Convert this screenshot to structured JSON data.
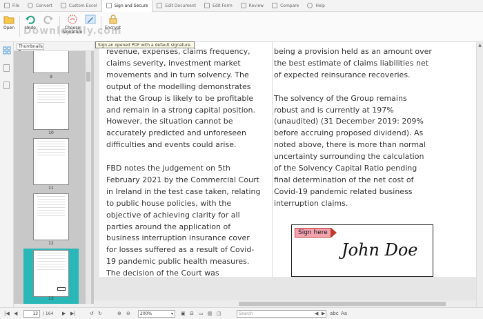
{
  "menubar": {
    "tabs": [
      {
        "label": "File",
        "icon": "file-icon"
      },
      {
        "label": "Convert",
        "icon": "convert-icon"
      },
      {
        "label": "Custom Excel",
        "icon": "table-icon"
      },
      {
        "label": "Sign and Secure",
        "icon": "sign-icon"
      },
      {
        "label": "Edit Document",
        "icon": "edit-icon"
      },
      {
        "label": "Edit Form",
        "icon": "form-icon"
      },
      {
        "label": "Review",
        "icon": "review-icon"
      },
      {
        "label": "Compare",
        "icon": "compare-icon"
      },
      {
        "label": "Help",
        "icon": "help-icon"
      }
    ]
  },
  "ribbon": {
    "open": "Open",
    "undo": "Undo",
    "choose_signature": "Choose Signature",
    "encrypt": "Encrypt",
    "watermark": "Downloadly.com"
  },
  "tooltip": "Sign an opened PDF with a default signature.",
  "thumbnails": {
    "dropdown": "Thumbnails",
    "pages": [
      "9",
      "10",
      "11",
      "12",
      "13"
    ]
  },
  "document": {
    "left_column": [
      "revenue, expenses, claims frequency, claims severity, investment market movements and in turn solvency. The output of the modelling demonstrates that the Group is likely to be profitable and remain in a strong capital position. However, the situation cannot be accurately predicted and unforeseen difficulties and events could arise.",
      "FBD notes the judgement on 5th February 2021 by the Commercial Court in Ireland in the test case taken, relating to public house policies, with the objective of achieving clarity for all parties around the application of business interruption insurance cover for losses suffered as a result of Covid-19 pandemic public health measures. The decision of the Court was"
    ],
    "right_column": [
      "being a provision held as an amount over the best estimate of claims liabilities net of expected reinsurance recoveries.",
      "The solvency of the Group remains robust and is currently at 197% (unaudited) (31 December 2019: 209% before accruing proposed dividend). As noted above, there is more than normal uncertainty surrounding the calculation of the Solvency Capital Ratio pending final determination of the net cost of Covid-19 pandemic related business interruption claims."
    ],
    "sign_here": "Sign here",
    "signature": "John Doe"
  },
  "statusbar": {
    "current_page": "13",
    "total_pages": "/ 164",
    "zoom": "200%",
    "search_placeholder": "Search"
  },
  "colors": {
    "thumb_active": "#29b7b7",
    "sign_tag": "#f4a3b0"
  }
}
